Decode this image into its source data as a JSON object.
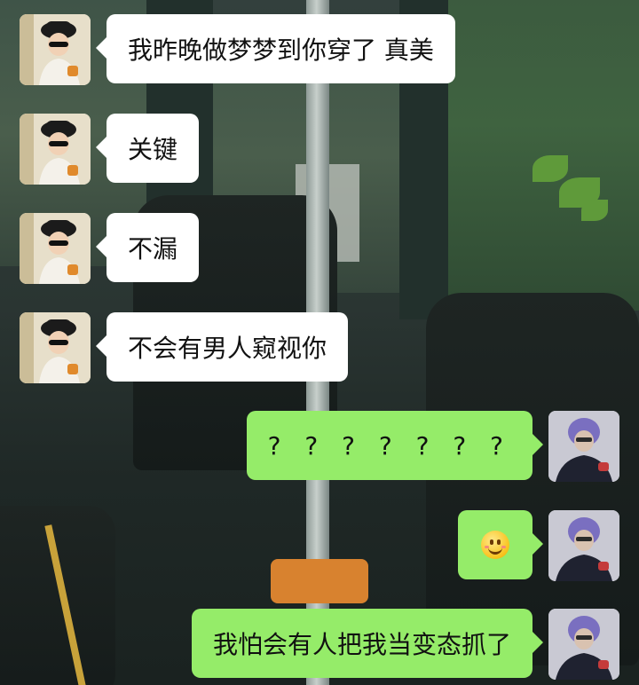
{
  "conversation": {
    "messages": [
      {
        "side": "left",
        "sender": "friend",
        "text": "我昨晚做梦梦到你穿了 真美"
      },
      {
        "side": "left",
        "sender": "friend",
        "text": "关键"
      },
      {
        "side": "left",
        "sender": "friend",
        "text": "不漏"
      },
      {
        "side": "left",
        "sender": "friend",
        "text": "不会有男人窥视你"
      },
      {
        "side": "right",
        "sender": "me",
        "text": "? ? ? ? ? ? ?"
      },
      {
        "side": "right",
        "sender": "me",
        "text": "",
        "emoji": "smiley-emoji"
      },
      {
        "side": "right",
        "sender": "me",
        "text": "我怕会有人把我当变态抓了"
      }
    ]
  },
  "avatars": {
    "friend": "avatar-girl-with-hat",
    "me": "avatar-old-man-purple-hair"
  },
  "colors": {
    "incoming_bubble": "#ffffff",
    "outgoing_bubble": "#95ec69",
    "text": "#111111"
  }
}
